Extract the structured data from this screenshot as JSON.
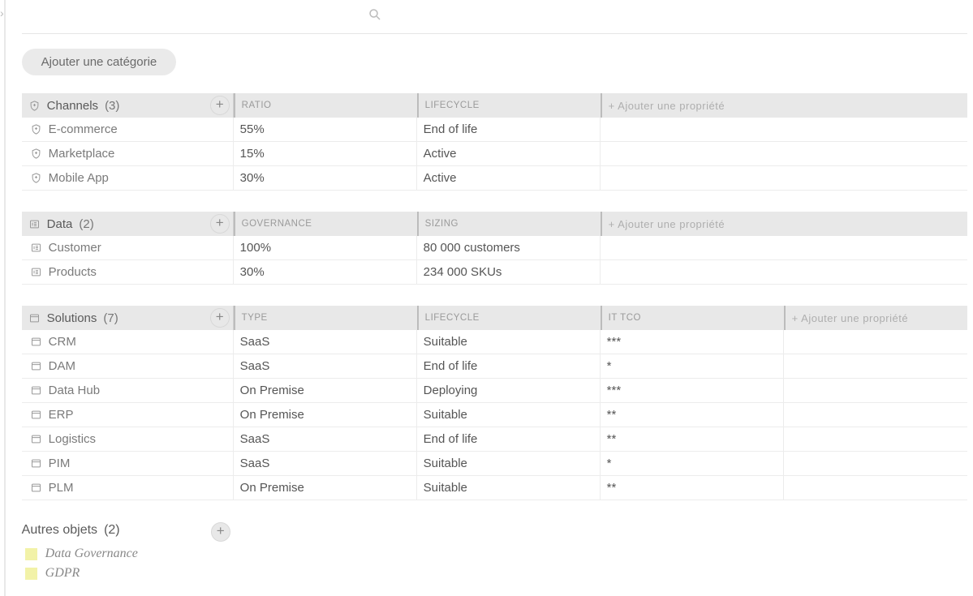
{
  "toolbar": {
    "add_category_label": "Ajouter une catégorie",
    "add_property_label": "+ Ajouter une propriété"
  },
  "search": {
    "placeholder": ""
  },
  "categories": [
    {
      "icon": "shield",
      "name": "Channels",
      "count": "(3)",
      "columns": [
        "RATIO",
        "LIFECYCLE"
      ],
      "rows": [
        {
          "name": "E-commerce",
          "values": [
            "55%",
            "End of life"
          ]
        },
        {
          "name": "Marketplace",
          "values": [
            "15%",
            "Active"
          ]
        },
        {
          "name": "Mobile App",
          "values": [
            "30%",
            "Active"
          ]
        }
      ]
    },
    {
      "icon": "id-card",
      "name": "Data",
      "count": "(2)",
      "columns": [
        "GOVERNANCE",
        "SIZING"
      ],
      "rows": [
        {
          "name": "Customer",
          "values": [
            "100%",
            "80 000 customers"
          ]
        },
        {
          "name": "Products",
          "values": [
            "30%",
            "234 000 SKUs"
          ]
        }
      ]
    },
    {
      "icon": "window",
      "name": "Solutions",
      "count": "(7)",
      "columns": [
        "TYPE",
        "LIFECYCLE",
        "IT TCO"
      ],
      "rows": [
        {
          "name": "CRM",
          "values": [
            "SaaS",
            "Suitable",
            "***"
          ]
        },
        {
          "name": "DAM",
          "values": [
            "SaaS",
            "End of life",
            "*"
          ]
        },
        {
          "name": "Data Hub",
          "values": [
            "On Premise",
            "Deploying",
            "***"
          ]
        },
        {
          "name": "ERP",
          "values": [
            "On Premise",
            "Suitable",
            "**"
          ]
        },
        {
          "name": "Logistics",
          "values": [
            "SaaS",
            "End of life",
            "**"
          ]
        },
        {
          "name": "PIM",
          "values": [
            "SaaS",
            "Suitable",
            "*"
          ]
        },
        {
          "name": "PLM",
          "values": [
            "On Premise",
            "Suitable",
            "**"
          ]
        }
      ]
    }
  ],
  "other": {
    "title": "Autres objets",
    "count": "(2)",
    "items": [
      {
        "label": "Data Governance",
        "color": "#f2f2a8"
      },
      {
        "label": "GDPR",
        "color": "#f2f2a8"
      }
    ]
  }
}
